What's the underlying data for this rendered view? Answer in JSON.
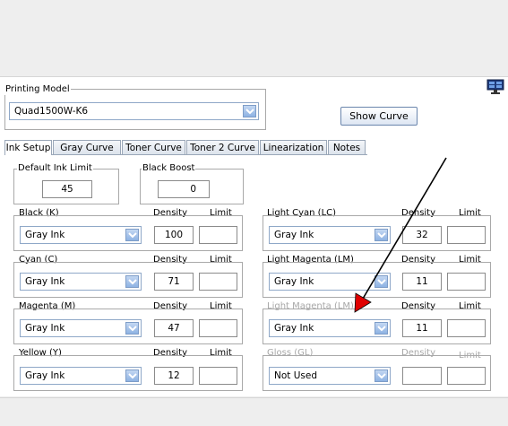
{
  "printing_model": {
    "legend": "Printing Model",
    "selected": "Quad1500W-K6"
  },
  "show_curve_label": "Show Curve",
  "tabs": [
    "Ink Setup",
    "Gray Curve",
    "Toner Curve",
    "Toner 2 Curve",
    "Linearization",
    "Notes"
  ],
  "default_ink_limit": {
    "legend": "Default Ink Limit",
    "value": "45"
  },
  "black_boost": {
    "legend": "Black Boost",
    "value": "0"
  },
  "column_headers": {
    "density": "Density",
    "limit": "Limit"
  },
  "channels": [
    {
      "name": "Black (K)",
      "ink": "Gray Ink",
      "density": "100",
      "limit": "",
      "disabled": false
    },
    {
      "name": "Cyan (C)",
      "ink": "Gray Ink",
      "density": "71",
      "limit": "",
      "disabled": false
    },
    {
      "name": "Magenta (M)",
      "ink": "Gray Ink",
      "density": "47",
      "limit": "",
      "disabled": false
    },
    {
      "name": "Yellow (Y)",
      "ink": "Gray Ink",
      "density": "12",
      "limit": "",
      "disabled": false
    },
    {
      "name": "Light Cyan (LC)",
      "ink": "Gray Ink",
      "density": "32",
      "limit": "",
      "disabled": false
    },
    {
      "name": "Light Magenta (LM)",
      "ink": "Gray Ink",
      "density": "11",
      "limit": "",
      "disabled": false
    },
    {
      "name": "Light Magenta (LM)",
      "ink": "Gray Ink",
      "density": "11",
      "limit": "",
      "disabled": true
    },
    {
      "name": "Gloss (GL)",
      "ink": "Not Used",
      "density": "",
      "limit": "",
      "disabled": true
    }
  ],
  "icons": {
    "monitor": "monitor-icon",
    "dropdown": "chevron-down-icon",
    "annotation": "red-arrow-annotation"
  },
  "colors": {
    "accent": "#8eb2e3",
    "annotation_arrow": "#e00000",
    "disabled_text": "#a7a7a7"
  }
}
